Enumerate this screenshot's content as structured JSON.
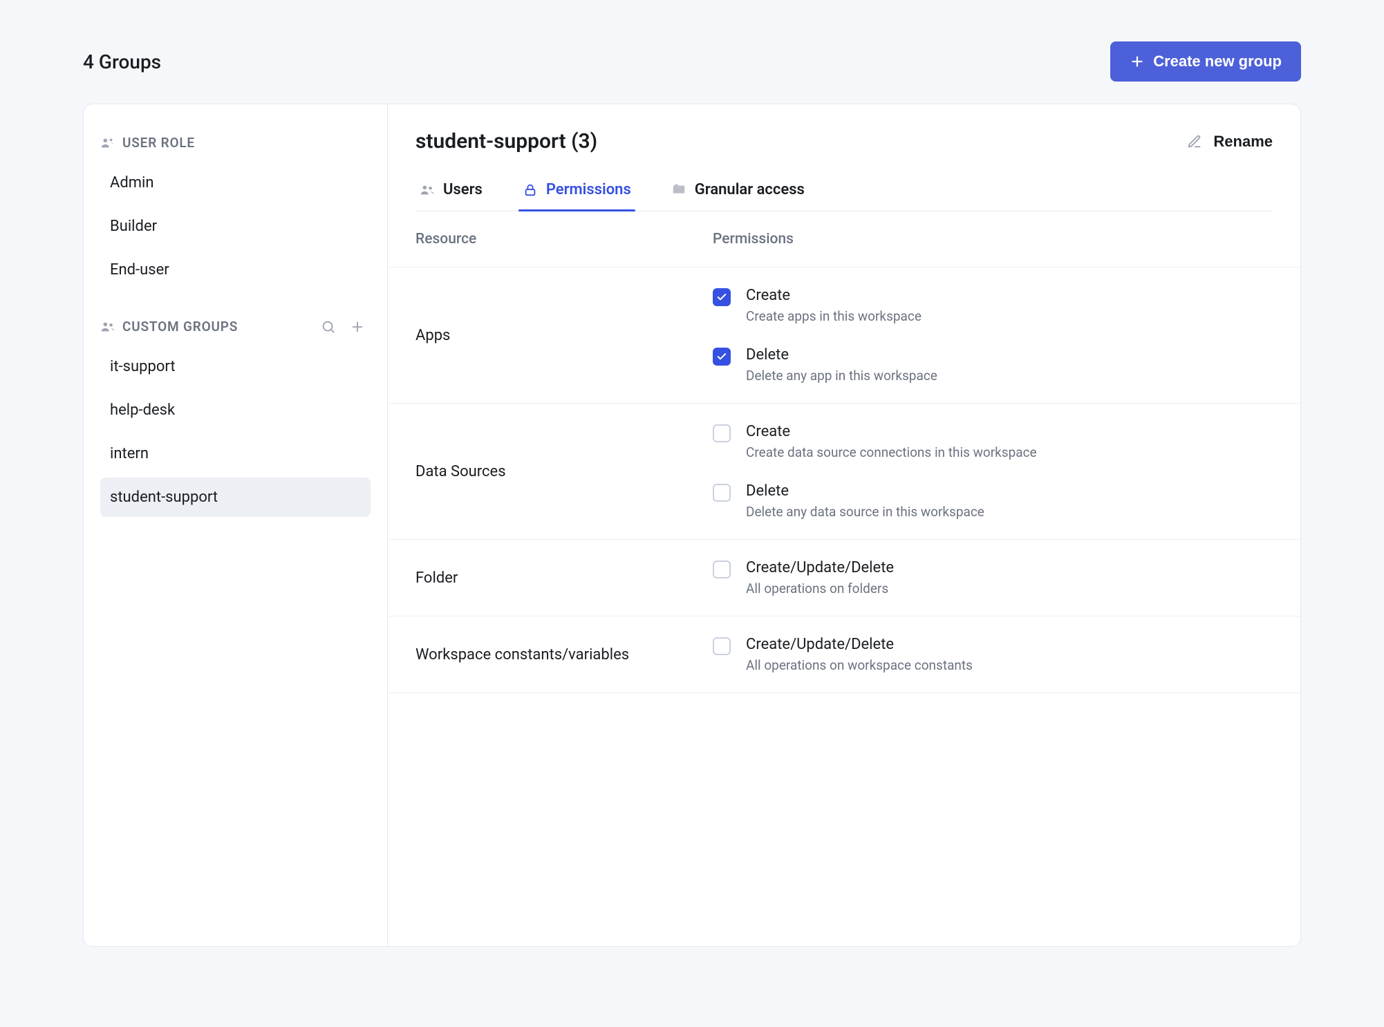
{
  "header": {
    "groups_label": "4 Groups",
    "create_label": "Create new group"
  },
  "sidebar": {
    "user_role_label": "USER ROLE",
    "custom_label": "CUSTOM GROUPS",
    "roles": [
      "Admin",
      "Builder",
      "End-user"
    ],
    "custom": [
      "it-support",
      "help-desk",
      "intern",
      "student-support"
    ],
    "active_custom_index": 3
  },
  "main": {
    "title": "student-support (3)",
    "rename_label": "Rename",
    "tabs": [
      {
        "label": "Users"
      },
      {
        "label": "Permissions"
      },
      {
        "label": "Granular access"
      }
    ],
    "active_tab_index": 1,
    "table_header": {
      "resource": "Resource",
      "permissions": "Permissions"
    },
    "rows": [
      {
        "resource": "Apps",
        "perms": [
          {
            "label": "Create",
            "desc": "Create apps in this workspace",
            "checked": true
          },
          {
            "label": "Delete",
            "desc": "Delete any app in this workspace",
            "checked": true
          }
        ]
      },
      {
        "resource": "Data Sources",
        "perms": [
          {
            "label": "Create",
            "desc": "Create data source connections in this workspace",
            "checked": false
          },
          {
            "label": "Delete",
            "desc": "Delete any data source in this workspace",
            "checked": false
          }
        ]
      },
      {
        "resource": "Folder",
        "perms": [
          {
            "label": "Create/Update/Delete",
            "desc": "All operations on folders",
            "checked": false
          }
        ]
      },
      {
        "resource": "Workspace constants/variables",
        "perms": [
          {
            "label": "Create/Update/Delete",
            "desc": "All operations on workspace constants",
            "checked": false
          }
        ]
      }
    ]
  }
}
